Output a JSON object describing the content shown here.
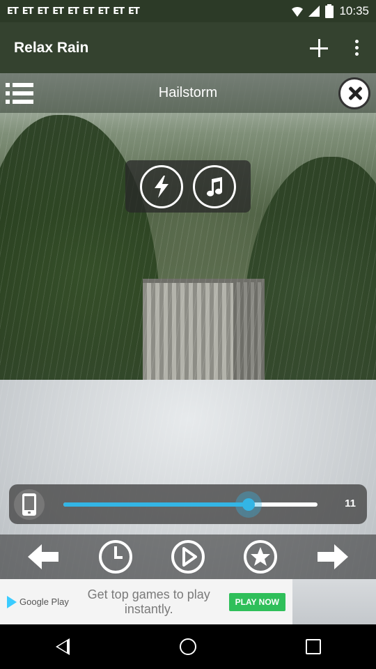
{
  "status_bar": {
    "notifications": [
      "ET",
      "ET",
      "ET",
      "ET",
      "ET",
      "ET",
      "ET",
      "ET",
      "ET"
    ],
    "time": "10:35"
  },
  "app_bar": {
    "title": "Relax Rain",
    "add_icon": "plus-icon",
    "more_icon": "more-vert-icon"
  },
  "sound": {
    "title": "Hailstorm",
    "list_icon": "list-icon",
    "close_icon": "close-icon"
  },
  "effects": {
    "thunder_icon": "lightning-icon",
    "music_icon": "music-note-icon"
  },
  "volume": {
    "value": "11",
    "level_fraction": 0.73,
    "accent_color": "#33b5e5"
  },
  "controls": {
    "prev_icon": "arrow-left-icon",
    "timer_icon": "clock-icon",
    "play_icon": "play-icon",
    "favorite_icon": "star-icon",
    "next_icon": "arrow-right-icon"
  },
  "ad": {
    "brand": "Google Play",
    "text": "Get top games to play instantly.",
    "cta": "PLAY NOW",
    "cta_color": "#2fbf5a"
  },
  "nav": {
    "back_icon": "back-icon",
    "home_icon": "home-icon",
    "recents_icon": "recents-icon"
  }
}
